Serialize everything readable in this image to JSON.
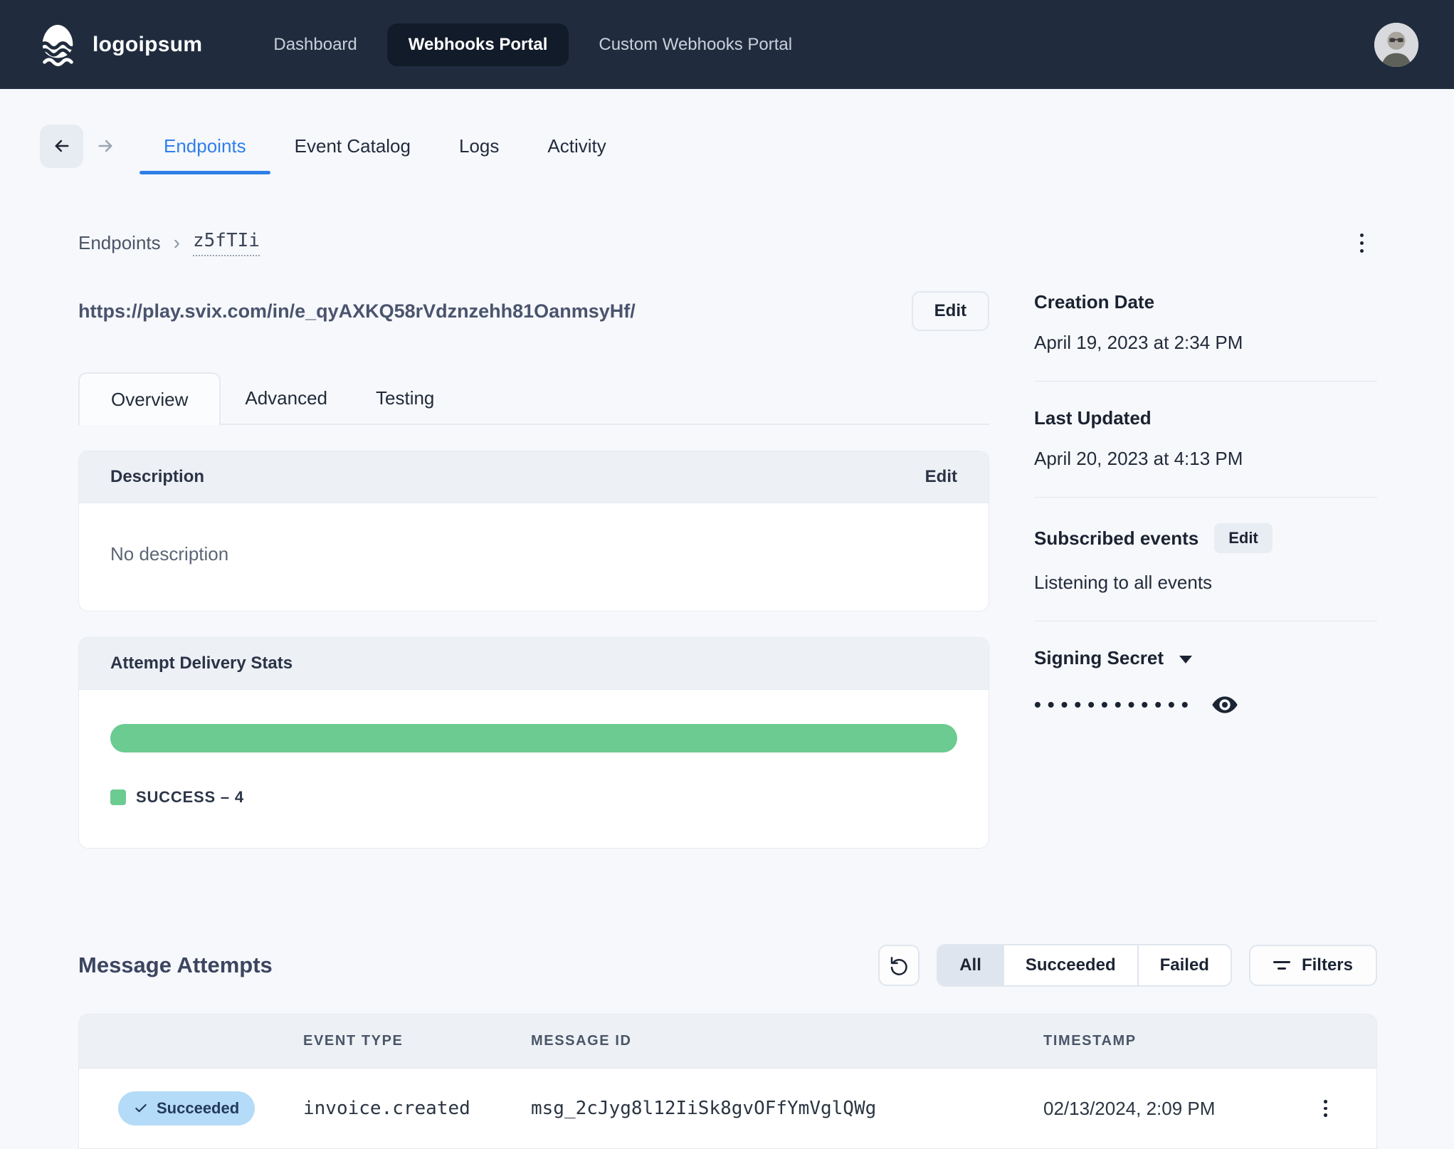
{
  "colors": {
    "navbar_bg": "#202c3e",
    "navbar_active_pill": "#121b29",
    "page_bg": "#f6f8fb",
    "accent_blue": "#2f7fe8",
    "success_green": "#6bcb90",
    "succeeded_pill_bg": "#b4dbf8",
    "card_header_bg": "#edf1f6"
  },
  "navbar": {
    "brand": "logoipsum",
    "items": [
      {
        "label": "Dashboard",
        "active": false
      },
      {
        "label": "Webhooks Portal",
        "active": true
      },
      {
        "label": "Custom Webhooks Portal",
        "active": false
      }
    ]
  },
  "tabbar": {
    "tabs": [
      {
        "label": "Endpoints",
        "active": true
      },
      {
        "label": "Event Catalog",
        "active": false
      },
      {
        "label": "Logs",
        "active": false
      },
      {
        "label": "Activity",
        "active": false
      }
    ]
  },
  "breadcrumb": {
    "root": "Endpoints",
    "separator": "›",
    "current": "z5fTIi"
  },
  "endpoint": {
    "url": "https://play.svix.com/in/e_qyAXKQ58rVdznzehh81OanmsyHf/",
    "edit_label": "Edit"
  },
  "detail_tabs": [
    {
      "label": "Overview",
      "active": true
    },
    {
      "label": "Advanced",
      "active": false
    },
    {
      "label": "Testing",
      "active": false
    }
  ],
  "description_card": {
    "title": "Description",
    "edit_label": "Edit",
    "empty_text": "No description"
  },
  "stats_card": {
    "title": "Attempt Delivery Stats",
    "legend_label": "SUCCESS – 4",
    "chart_data": {
      "type": "bar",
      "series": [
        {
          "name": "SUCCESS",
          "value": 4,
          "fraction": 1.0,
          "color": "#6bcb90"
        }
      ]
    }
  },
  "sidebar": {
    "creation_date": {
      "label": "Creation Date",
      "value": "April 19, 2023 at 2:34 PM"
    },
    "last_updated": {
      "label": "Last Updated",
      "value": "April 20, 2023 at 4:13 PM"
    },
    "subscribed_events": {
      "label": "Subscribed events",
      "edit_label": "Edit",
      "value": "Listening to all events"
    },
    "signing_secret": {
      "label": "Signing Secret",
      "masked_value": "••••••••••••"
    }
  },
  "attempts": {
    "title": "Message Attempts",
    "filter_tabs": [
      {
        "label": "All",
        "active": true
      },
      {
        "label": "Succeeded",
        "active": false
      },
      {
        "label": "Failed",
        "active": false
      }
    ],
    "filters_label": "Filters",
    "table": {
      "columns": [
        "EVENT TYPE",
        "MESSAGE ID",
        "TIMESTAMP"
      ],
      "rows": [
        {
          "status": "Succeeded",
          "event_type": "invoice.created",
          "message_id": "msg_2cJyg8l12IiSk8gvOFfYmVglQWg",
          "timestamp": "02/13/2024, 2:09 PM"
        }
      ]
    }
  }
}
